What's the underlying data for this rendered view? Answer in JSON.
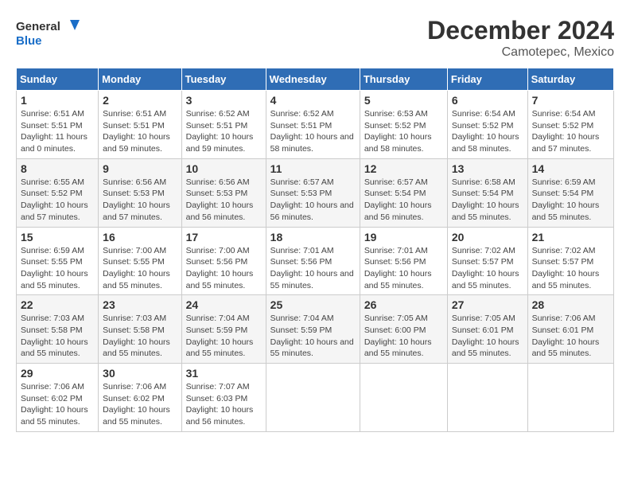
{
  "logo": {
    "line1": "General",
    "line2": "Blue"
  },
  "title": "December 2024",
  "subtitle": "Camotepec, Mexico",
  "weekdays": [
    "Sunday",
    "Monday",
    "Tuesday",
    "Wednesday",
    "Thursday",
    "Friday",
    "Saturday"
  ],
  "weeks": [
    [
      {
        "day": "1",
        "sunrise": "6:51 AM",
        "sunset": "5:51 PM",
        "daylight": "11 hours and 0 minutes."
      },
      {
        "day": "2",
        "sunrise": "6:51 AM",
        "sunset": "5:51 PM",
        "daylight": "10 hours and 59 minutes."
      },
      {
        "day": "3",
        "sunrise": "6:52 AM",
        "sunset": "5:51 PM",
        "daylight": "10 hours and 59 minutes."
      },
      {
        "day": "4",
        "sunrise": "6:52 AM",
        "sunset": "5:51 PM",
        "daylight": "10 hours and 58 minutes."
      },
      {
        "day": "5",
        "sunrise": "6:53 AM",
        "sunset": "5:52 PM",
        "daylight": "10 hours and 58 minutes."
      },
      {
        "day": "6",
        "sunrise": "6:54 AM",
        "sunset": "5:52 PM",
        "daylight": "10 hours and 58 minutes."
      },
      {
        "day": "7",
        "sunrise": "6:54 AM",
        "sunset": "5:52 PM",
        "daylight": "10 hours and 57 minutes."
      }
    ],
    [
      {
        "day": "8",
        "sunrise": "6:55 AM",
        "sunset": "5:52 PM",
        "daylight": "10 hours and 57 minutes."
      },
      {
        "day": "9",
        "sunrise": "6:56 AM",
        "sunset": "5:53 PM",
        "daylight": "10 hours and 57 minutes."
      },
      {
        "day": "10",
        "sunrise": "6:56 AM",
        "sunset": "5:53 PM",
        "daylight": "10 hours and 56 minutes."
      },
      {
        "day": "11",
        "sunrise": "6:57 AM",
        "sunset": "5:53 PM",
        "daylight": "10 hours and 56 minutes."
      },
      {
        "day": "12",
        "sunrise": "6:57 AM",
        "sunset": "5:54 PM",
        "daylight": "10 hours and 56 minutes."
      },
      {
        "day": "13",
        "sunrise": "6:58 AM",
        "sunset": "5:54 PM",
        "daylight": "10 hours and 55 minutes."
      },
      {
        "day": "14",
        "sunrise": "6:59 AM",
        "sunset": "5:54 PM",
        "daylight": "10 hours and 55 minutes."
      }
    ],
    [
      {
        "day": "15",
        "sunrise": "6:59 AM",
        "sunset": "5:55 PM",
        "daylight": "10 hours and 55 minutes."
      },
      {
        "day": "16",
        "sunrise": "7:00 AM",
        "sunset": "5:55 PM",
        "daylight": "10 hours and 55 minutes."
      },
      {
        "day": "17",
        "sunrise": "7:00 AM",
        "sunset": "5:56 PM",
        "daylight": "10 hours and 55 minutes."
      },
      {
        "day": "18",
        "sunrise": "7:01 AM",
        "sunset": "5:56 PM",
        "daylight": "10 hours and 55 minutes."
      },
      {
        "day": "19",
        "sunrise": "7:01 AM",
        "sunset": "5:56 PM",
        "daylight": "10 hours and 55 minutes."
      },
      {
        "day": "20",
        "sunrise": "7:02 AM",
        "sunset": "5:57 PM",
        "daylight": "10 hours and 55 minutes."
      },
      {
        "day": "21",
        "sunrise": "7:02 AM",
        "sunset": "5:57 PM",
        "daylight": "10 hours and 55 minutes."
      }
    ],
    [
      {
        "day": "22",
        "sunrise": "7:03 AM",
        "sunset": "5:58 PM",
        "daylight": "10 hours and 55 minutes."
      },
      {
        "day": "23",
        "sunrise": "7:03 AM",
        "sunset": "5:58 PM",
        "daylight": "10 hours and 55 minutes."
      },
      {
        "day": "24",
        "sunrise": "7:04 AM",
        "sunset": "5:59 PM",
        "daylight": "10 hours and 55 minutes."
      },
      {
        "day": "25",
        "sunrise": "7:04 AM",
        "sunset": "5:59 PM",
        "daylight": "10 hours and 55 minutes."
      },
      {
        "day": "26",
        "sunrise": "7:05 AM",
        "sunset": "6:00 PM",
        "daylight": "10 hours and 55 minutes."
      },
      {
        "day": "27",
        "sunrise": "7:05 AM",
        "sunset": "6:01 PM",
        "daylight": "10 hours and 55 minutes."
      },
      {
        "day": "28",
        "sunrise": "7:06 AM",
        "sunset": "6:01 PM",
        "daylight": "10 hours and 55 minutes."
      }
    ],
    [
      {
        "day": "29",
        "sunrise": "7:06 AM",
        "sunset": "6:02 PM",
        "daylight": "10 hours and 55 minutes."
      },
      {
        "day": "30",
        "sunrise": "7:06 AM",
        "sunset": "6:02 PM",
        "daylight": "10 hours and 55 minutes."
      },
      {
        "day": "31",
        "sunrise": "7:07 AM",
        "sunset": "6:03 PM",
        "daylight": "10 hours and 56 minutes."
      },
      null,
      null,
      null,
      null
    ]
  ]
}
